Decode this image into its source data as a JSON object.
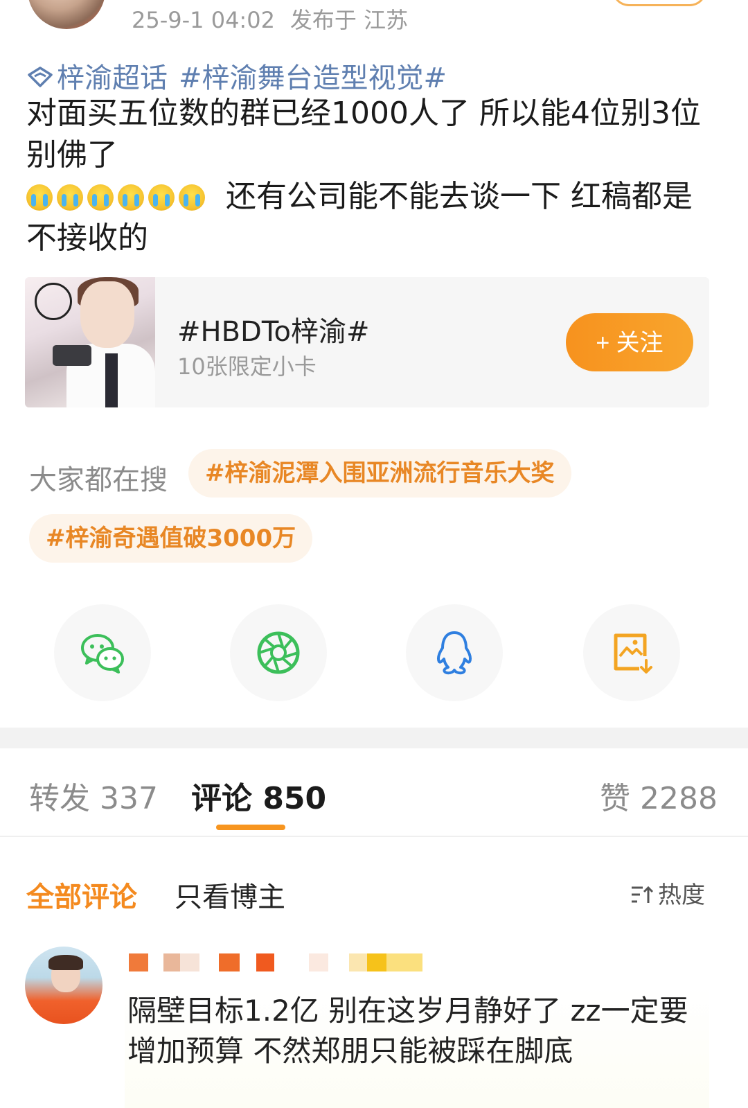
{
  "header": {
    "timestamp": "25-9-1 04:02",
    "location": "发布于 江苏"
  },
  "post": {
    "topic_super": "梓渝超话",
    "topic_tag": "#梓渝舞台造型视觉#",
    "line1": "对面买五位数的群已经1000人了 所以能4位别3位别佛了",
    "emoji_count": 6,
    "line2": "还有公司能不能去谈一下 红稿都是不接收的"
  },
  "topic_card": {
    "title": "#HBDTo梓渝#",
    "subtitle": "10张限定小卡",
    "follow_label": "+ 关注"
  },
  "hot_search": {
    "label": "大家都在搜",
    "tags": [
      "#梓渝泥潭入围亚洲流行音乐大奖",
      "#梓渝奇遇值破3000万"
    ]
  },
  "share": {
    "icons": [
      "wechat-icon",
      "moments-icon",
      "qq-icon",
      "save-image-icon"
    ],
    "colors": {
      "wechat": "#3cbf5a",
      "moments": "#3cbf5a",
      "qq": "#2f7fe0",
      "save": "#f3a422"
    }
  },
  "tabs": {
    "repost": "转发 337",
    "comment": "评论 850",
    "like": "赞 2288"
  },
  "filters": {
    "all": "全部评论",
    "host_only": "只看博主",
    "sort": "热度"
  },
  "comment": {
    "text": "隔壁目标1.2亿 别在这岁月静好了 zz一定要增加预算 不然郑朋只能被踩在脚底"
  },
  "colors": {
    "accent": "#f7951f",
    "topic_blue": "#5f7fb0",
    "tag_bg": "#fdf4ea",
    "tag_text": "#e88725"
  }
}
